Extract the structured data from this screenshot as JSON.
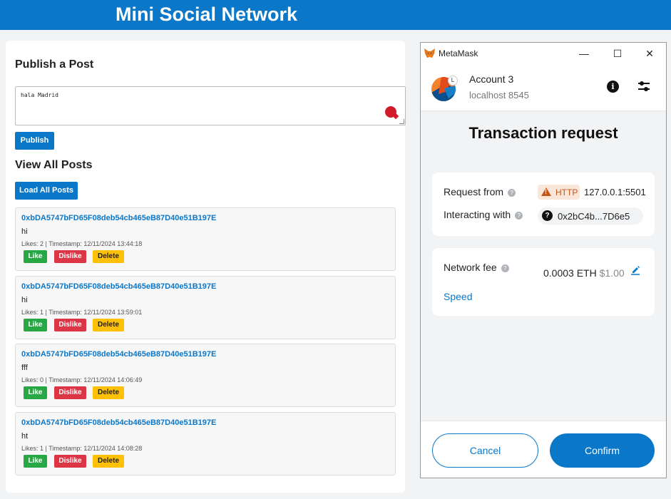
{
  "app": {
    "title": "Mini Social Network",
    "brand_color": "#0b77c8"
  },
  "publish": {
    "heading": "Publish a Post",
    "input_value": "hala Madrid",
    "button_label": "Publish"
  },
  "view": {
    "heading": "View All Posts",
    "button_label": "Load All Posts"
  },
  "posts": [
    {
      "author": "0xbDA5747bFD65F08deb54cb465eB87D40e51B197E",
      "content": "hi",
      "meta": "Likes: 2 | Timestamp: 12/11/2024 13:44:18",
      "like": "Like",
      "dislike": "Dislike",
      "delete": "Delete"
    },
    {
      "author": "0xbDA5747bFD65F08deb54cb465eB87D40e51B197E",
      "content": "hi",
      "meta": "Likes: 1 | Timestamp: 12/11/2024 13:59:01",
      "like": "Like",
      "dislike": "Dislike",
      "delete": "Delete"
    },
    {
      "author": "0xbDA5747bFD65F08deb54cb465eB87D40e51B197E",
      "content": "fff",
      "meta": "Likes: 0 | Timestamp: 12/11/2024 14:06:49",
      "like": "Like",
      "dislike": "Dislike",
      "delete": "Delete"
    },
    {
      "author": "0xbDA5747bFD65F08deb54cb465eB87D40e51B197E",
      "content": "ht",
      "meta": "Likes: 1 | Timestamp: 12/11/2024 14:08:28",
      "like": "Like",
      "dislike": "Dislike",
      "delete": "Delete"
    }
  ],
  "metamask": {
    "window_title": "MetaMask",
    "window_controls": {
      "minimize": "—",
      "maximize": "☐",
      "close": "✕"
    },
    "account_name": "Account 3",
    "network": "localhost 8545",
    "avatar_badge": "L",
    "heading": "Transaction request",
    "request_from_label": "Request from",
    "http_badge": "HTTP",
    "origin": "127.0.0.1:5501",
    "interacting_label": "Interacting with",
    "contract_address": "0x2bC4b...7D6e5",
    "network_fee_label": "Network fee",
    "fee_eth": "0.0003 ETH",
    "fee_usd": "$1.00",
    "speed_label": "Speed",
    "cancel_label": "Cancel",
    "confirm_label": "Confirm",
    "help_glyph": "?",
    "info_glyph": "i"
  }
}
